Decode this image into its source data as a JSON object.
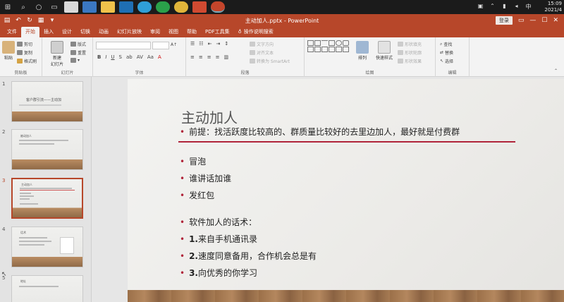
{
  "taskbar": {
    "clock_time": "15:09",
    "clock_date": "2021/4"
  },
  "titlebar": {
    "document_title": "主动加人.pptx - PowerPoint",
    "login_label": "登录",
    "accent": "#b7472a"
  },
  "tabs": [
    {
      "label": "文件"
    },
    {
      "label": "开始"
    },
    {
      "label": "插入"
    },
    {
      "label": "设计"
    },
    {
      "label": "切换"
    },
    {
      "label": "动画"
    },
    {
      "label": "幻灯片放映"
    },
    {
      "label": "审阅"
    },
    {
      "label": "视图"
    },
    {
      "label": "帮助"
    },
    {
      "label": "PDF工具集"
    }
  ],
  "tell_me": "操作说明搜索",
  "ribbon": {
    "clipboard": {
      "paste": "粘贴",
      "cut": "剪切",
      "copy": "复制",
      "format_painter": "格式刷",
      "group": "剪贴板"
    },
    "slides": {
      "new_slide": "新建\n幻灯片",
      "layout": "版式",
      "reset": "重置",
      "group": "幻灯片"
    },
    "font": {
      "group": "字体"
    },
    "paragraph": {
      "text_direction": "文字方向",
      "align_text": "对齐文本",
      "smartart": "转换为 SmartArt",
      "group": "段落"
    },
    "drawing": {
      "arrange": "排列",
      "quick_styles": "快速样式",
      "fill": "形状填充",
      "outline": "形状轮廓",
      "effects": "形状效果",
      "group": "绘图"
    },
    "editing": {
      "find": "查找",
      "replace": "替换",
      "select": "选择",
      "group": "编辑"
    }
  },
  "thumbnails": [
    {
      "number": "1",
      "title": "客户群引流——主动加"
    },
    {
      "number": "2",
      "title": "被动加人"
    },
    {
      "number": "3",
      "title": "主动加人"
    },
    {
      "number": "4",
      "title": "话术"
    },
    {
      "number": "5",
      "title": "地址"
    }
  ],
  "slide": {
    "title": "主动加人",
    "premise": "前提：找活跃度比较高的、群质量比较好的去里边加人，最好就是付费群",
    "bullets": [
      "冒泡",
      "谁讲话加谁",
      "发红包"
    ],
    "script_heading": "软件加人的话术：",
    "script_items": [
      {
        "num": "1.",
        "text": "来自手机通讯录"
      },
      {
        "num": "2.",
        "text": "速度同意备用，合作机会总是有"
      },
      {
        "num": "3.",
        "text": "向优秀的你学习"
      }
    ]
  }
}
